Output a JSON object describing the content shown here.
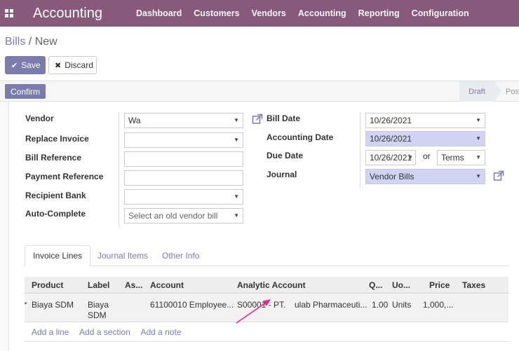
{
  "app": {
    "title": "Accounting",
    "nav": [
      "Dashboard",
      "Customers",
      "Vendors",
      "Accounting",
      "Reporting",
      "Configuration"
    ]
  },
  "breadcrumb": {
    "parent": "Bills",
    "separator": " / ",
    "current": "New"
  },
  "toolbar": {
    "save_label": "Save",
    "discard_label": "Discard"
  },
  "status": {
    "confirm_label": "Confirm",
    "stage_draft": "Draft",
    "stage_posted": "Pos"
  },
  "form": {
    "left": [
      {
        "label": "Vendor",
        "value": "Wa"
      },
      {
        "label": "Replace Invoice",
        "value": ""
      },
      {
        "label": "Bill Reference",
        "value": ""
      },
      {
        "label": "Payment Reference",
        "value": ""
      },
      {
        "label": "Recipient Bank",
        "value": ""
      },
      {
        "label": "Auto-Complete",
        "value": "Select an old vendor bill"
      }
    ],
    "right": {
      "bill_date_label": "Bill Date",
      "bill_date": "10/26/2021",
      "accounting_date_label": "Accounting Date",
      "accounting_date": "10/26/2021",
      "due_date_label": "Due Date",
      "due_date": "10/26/2021",
      "or_text": "or",
      "terms": "Terms",
      "journal_label": "Journal",
      "journal": "Vendor Bills"
    }
  },
  "tabs": [
    "Invoice Lines",
    "Journal Items",
    "Other Info"
  ],
  "table": {
    "headers": [
      "Product",
      "Label",
      "As...",
      "Account",
      "Analytic Account",
      "Q...",
      "Uo...",
      "Price",
      "Taxes"
    ],
    "rows": [
      {
        "product": "Biaya SDM",
        "label_line1": "Biaya",
        "label_line2": "SDM",
        "account": "61100010 Employee...",
        "analytic": "S00001 - PT.",
        "analytic_rest": "ulab Pharmaceuti...",
        "qty": "1.00",
        "uom": "Units",
        "price": "1,000,..."
      }
    ],
    "add_line": "Add a line",
    "add_section": "Add a section",
    "add_note": "Add a note"
  },
  "colors": {
    "brand": "#875a7b",
    "accent": "#7c7bad",
    "highlight": "#d2d3f2",
    "annotation": "#e8288a"
  }
}
